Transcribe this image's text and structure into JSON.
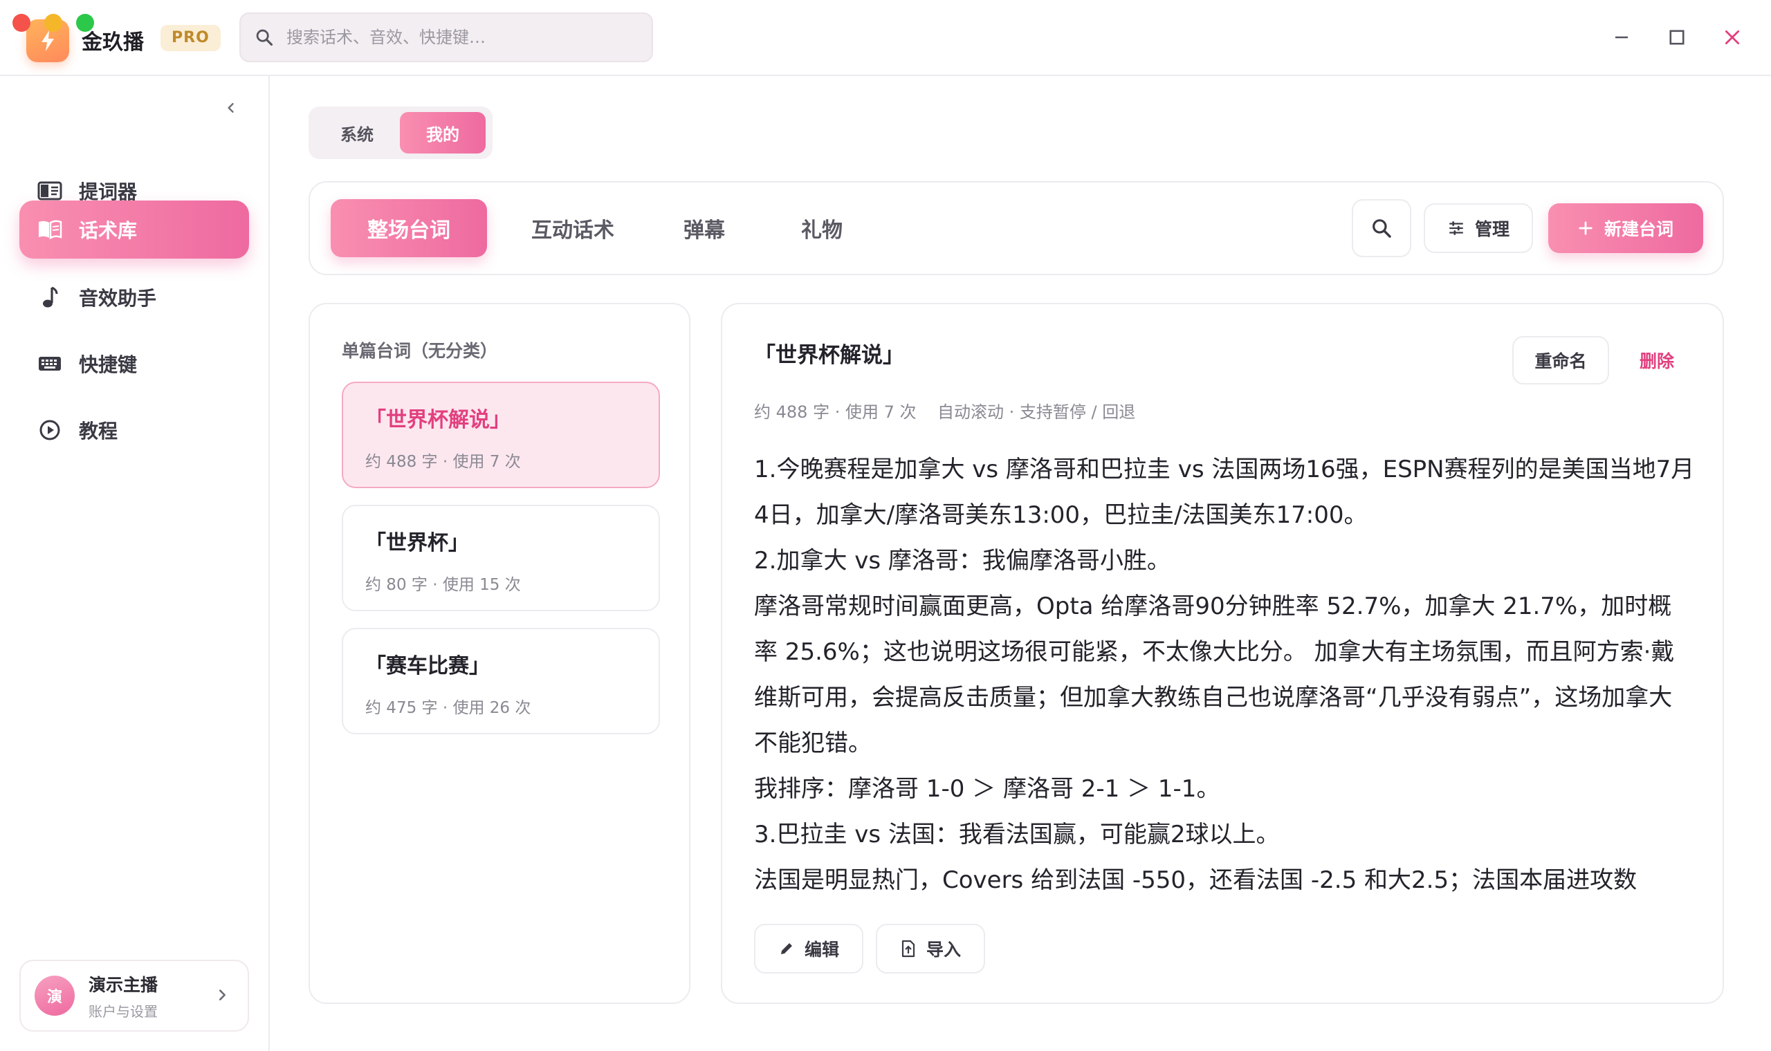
{
  "app": {
    "name": "金玖播",
    "badge": "PRO",
    "search_placeholder": "搜索话术、音效、快捷键…"
  },
  "colors": {
    "accent": "#ee6aa0",
    "accent_light": "#f98fb0",
    "delete": "#e2407f",
    "close": "#e2407f"
  },
  "sidebar": {
    "items": [
      {
        "label": "提词器",
        "icon": "teleprompter-icon"
      },
      {
        "label": "话术库",
        "icon": "book-icon",
        "active": true
      },
      {
        "label": "音效助手",
        "icon": "music-note-icon"
      },
      {
        "label": "快捷键",
        "icon": "keyboard-icon"
      },
      {
        "label": "教程",
        "icon": "play-circle-icon"
      }
    ],
    "profile": {
      "avatar_text": "演",
      "name": "演示主播",
      "subtitle": "账户与设置"
    }
  },
  "segment": {
    "options": [
      "系统",
      "我的"
    ],
    "selected": "我的"
  },
  "tabs": {
    "items": [
      "整场台词",
      "互动话术",
      "弹幕",
      "礼物"
    ],
    "selected": "整场台词",
    "manage_label": "管理",
    "new_label": "新建台词"
  },
  "list": {
    "heading": "单篇台词（无分类）",
    "scripts": [
      {
        "title": "「世界杯解说」",
        "meta": "约 488 字 · 使用 7 次",
        "active": true
      },
      {
        "title": "「世界杯」",
        "meta": "约 80 字 · 使用 15 次"
      },
      {
        "title": "「赛车比赛」",
        "meta": "约 475 字 · 使用 26 次"
      }
    ]
  },
  "detail": {
    "title": "「世界杯解说」",
    "rename_label": "重命名",
    "delete_label": "删除",
    "meta": "约 488 字 · 使用 7 次    自动滚动 · 支持暂停 / 回退",
    "body": [
      "1.今晚赛程是加拿大 vs 摩洛哥和巴拉圭 vs 法国两场16强，ESPN赛程列的是美国当地7月4日，加拿大/摩洛哥美东13:00，巴拉圭/法国美东17:00。",
      "2.加拿大 vs 摩洛哥：我偏摩洛哥小胜。",
      "摩洛哥常规时间赢面更高，Opta 给摩洛哥90分钟胜率 52.7%，加拿大 21.7%，加时概率 25.6%；这也说明这场很可能紧，不太像大比分。 加拿大有主场氛围，而且阿方索·戴维斯可用，会提高反击质量；但加拿大教练自己也说摩洛哥“几乎没有弱点”，这场加拿大不能犯错。",
      "我排序：摩洛哥 1-0 ＞ 摩洛哥 2-1 ＞ 1-1。",
      "3.巴拉圭 vs 法国：我看法国赢，可能赢2球以上。",
      "法国是明显热门，Covers 给到法国 -550，还看法国 -2.5 和大2.5；法国本届进攻数"
    ],
    "edit_label": "编辑",
    "import_label": "导入"
  }
}
